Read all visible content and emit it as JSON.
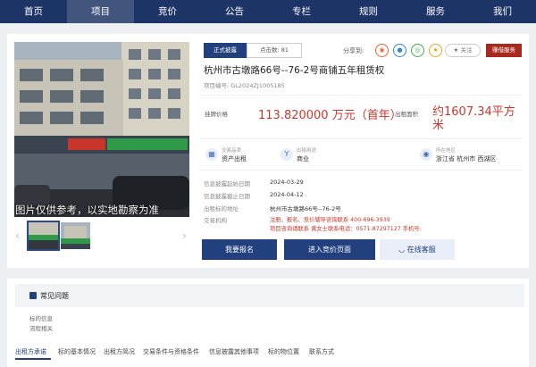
{
  "nav": {
    "items": [
      "首页",
      "项目",
      "竞价",
      "公告",
      "专栏",
      "规则",
      "服务",
      "我们"
    ],
    "active_index": 1
  },
  "project": {
    "status": "正式披露",
    "clicks": "点击数: 81",
    "share_label": "分享到:",
    "follow": "关注",
    "reg_button": "赚借服务",
    "title": "杭州市古墩路66号--76-2号商铺五年租赁权",
    "project_no": "项目编号: GL2024ZJ1005185",
    "price_label": "挂牌价格",
    "price": "113.820000 万元（首年）",
    "area_label": "出租面积",
    "area": "约1607.34平方米",
    "photo_caption": "图片仅供参考，以实地勘察为准"
  },
  "facts": [
    {
      "label": "交易品类",
      "value": "资产出租",
      "icon": "grid-icon"
    },
    {
      "label": "出租用途",
      "value": "商业",
      "icon": "tag-icon"
    },
    {
      "label": "所在地区",
      "value": "浙江省 杭州市 西湖区",
      "icon": "location-icon"
    }
  ],
  "info": [
    {
      "label": "信息披露起始日期",
      "value": "2024-03-29"
    },
    {
      "label": "信息披露截止日期",
      "value": "2024-04-12"
    },
    {
      "label": "出租标的地址",
      "value": "杭州市古墩路66号--76-2号"
    }
  ],
  "org": {
    "label": "交易机构",
    "line1": "注册、报名、竞价辅导咨询联系 400-696-3939",
    "line2": "项目咨询请联系 黄女士联系电话：0571-87297127 手机号:"
  },
  "buttons": {
    "signup": "我要报名",
    "enter": "进入竞价页面",
    "service": "在线客服"
  },
  "faq": {
    "title": "常见问题",
    "items": [
      "标的信息",
      "流程相关"
    ]
  },
  "tabs": {
    "items": [
      "出租方承诺",
      "标的基本情况",
      "出租方简况",
      "交易条件与资格条件",
      "信息披露其他事项",
      "标的物位置",
      "联系方式"
    ],
    "active_index": 0
  },
  "colors": {
    "nav_bg": "#1d3466",
    "primary": "#21407d",
    "accent_red": "#d0352b"
  }
}
